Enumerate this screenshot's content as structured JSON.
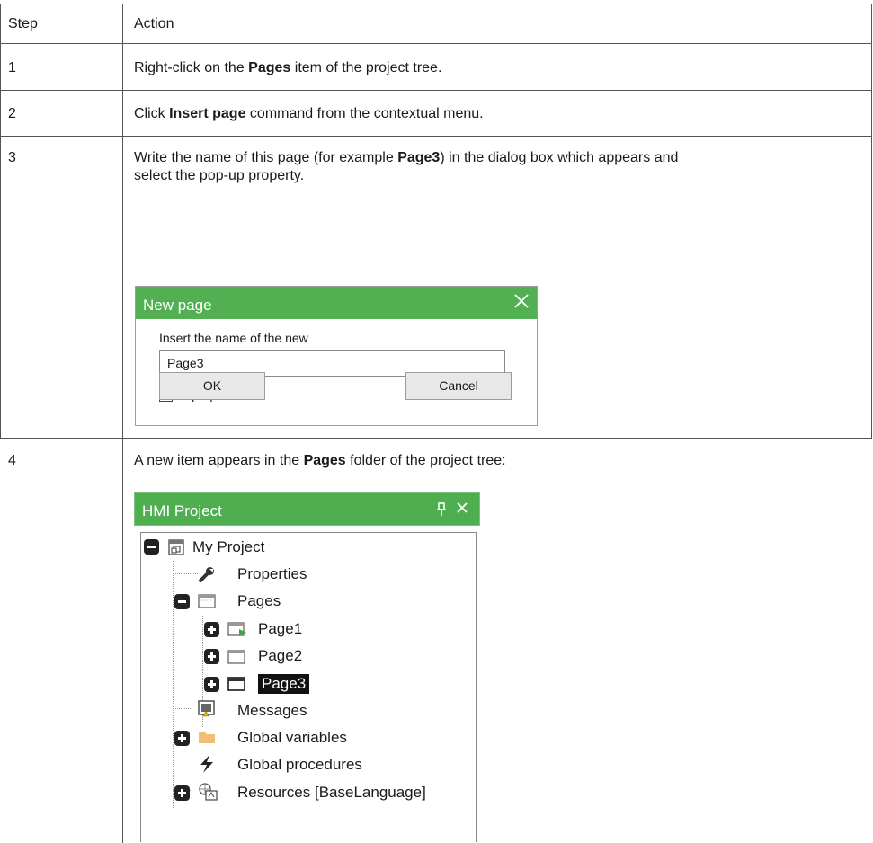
{
  "table": {
    "headers": [
      "Step",
      "Action"
    ],
    "rows": [
      {
        "step": "1",
        "action": {
          "before": "Right-click on the ",
          "bold": "Pages",
          "after": " item of the project tree."
        }
      },
      {
        "step": "2",
        "action": {
          "before": "Click ",
          "bold": "Insert page",
          "after": " command from the contextual menu."
        }
      },
      {
        "step": "3",
        "action": {
          "line1_before": "Write the name of this page (for example ",
          "bold": "Page3",
          "line1_after": ") in the dialog box which appears and",
          "line2": "select the pop-up property."
        }
      },
      {
        "step": "4",
        "action": {
          "before": "A new item appears in the ",
          "bold": "Pages",
          "after": " folder of the project tree:"
        }
      }
    ]
  },
  "dialog": {
    "title": "New page",
    "close_icon": "close-x",
    "label": "Insert the name of the new",
    "input_value": "Page3",
    "checkbox_checked": true,
    "checkbox_label": "Pop-up",
    "ok_label": "OK",
    "cancel_label": "Cancel",
    "title_color": "#52b052"
  },
  "tree": {
    "title": "HMI Project",
    "pin_icon": "pin",
    "close_icon": "close-x",
    "header_color": "#4fae4f",
    "items": {
      "my_project": "My Project",
      "properties": "Properties",
      "pages": "Pages",
      "page1": "Page1",
      "page2": "Page2",
      "page3": "Page3",
      "messages": "Messages",
      "global_variables": "Global variables",
      "global_procedures": "Global procedures",
      "resources": "Resources [BaseLanguage]"
    },
    "selected_item": "Page3"
  }
}
